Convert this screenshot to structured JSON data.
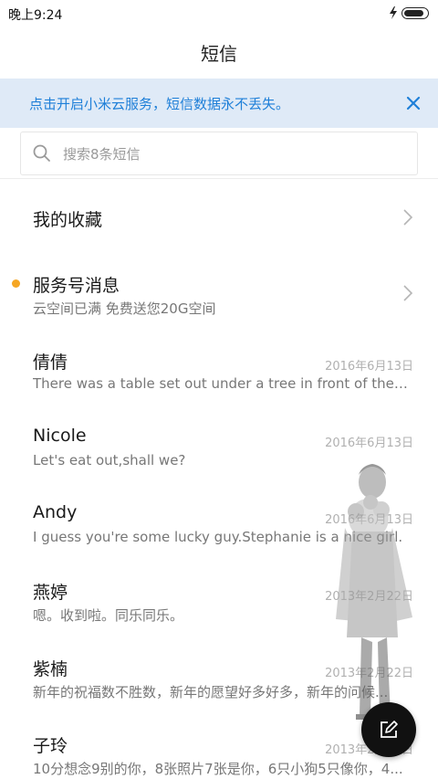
{
  "status_bar": {
    "time": "晚上9:24",
    "battery_level": 0.9
  },
  "header": {
    "title": "短信"
  },
  "banner": {
    "text": "点击开启小米云服务，短信数据永不丢失。"
  },
  "search": {
    "placeholder": "搜索8条短信"
  },
  "favorites": {
    "title": "我的收藏"
  },
  "service": {
    "title": "服务号消息",
    "subtitle": "云空间已满 免费送您20G空间"
  },
  "conversations": [
    {
      "name": "倩倩",
      "preview": "There was a table set out under a tree in front of the ho...",
      "date": "2016年6月13日"
    },
    {
      "name": "Nicole",
      "preview": "Let's eat out,shall we?",
      "date": "2016年6月13日"
    },
    {
      "name": "Andy",
      "preview": "I guess you're some lucky guy.Stephanie is a nice girl.",
      "date": "2016年6月13日"
    },
    {
      "name": "燕婷",
      "preview": "嗯。收到啦。同乐同乐。",
      "date": "2013年2月22日"
    },
    {
      "name": "紫楠",
      "preview": "新年的祝福数不胜数，新年的愿望好多好多，新年的问候...",
      "date": "2013年2月22日"
    },
    {
      "name": "子玲",
      "preview": "10分想念9别的你，8张照片7张是你，6只小狗5只像你，4...",
      "date": "2013年2月22日"
    }
  ],
  "colors": {
    "accent": "#1e7fd8",
    "banner_bg": "#dfeaf7",
    "unread_dot": "#f5a623",
    "fab_bg": "#111111"
  },
  "icons": {
    "banner_close": "close-icon",
    "search": "search-icon",
    "chevron": "chevron-right-icon",
    "fab": "compose-icon"
  }
}
